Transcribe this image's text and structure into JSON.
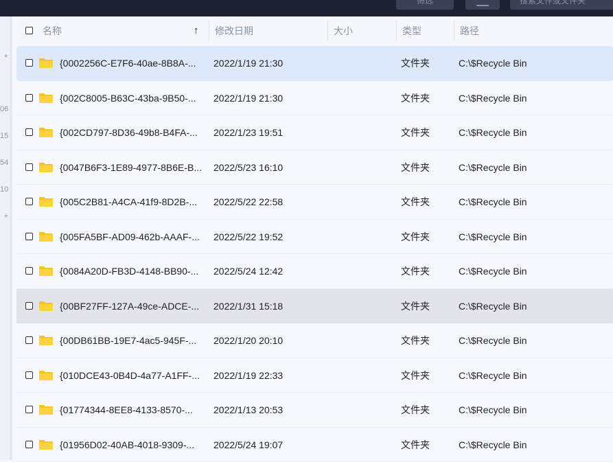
{
  "toolbar": {
    "filter_label": "筛选",
    "search_placeholder": "搜索文件或文件夹"
  },
  "sidebar": {
    "partial_labels": [
      "+",
      "06",
      "15",
      "54",
      "10",
      "+"
    ]
  },
  "table": {
    "columns": {
      "name": "名称",
      "modified": "修改日期",
      "size": "大小",
      "type": "类型",
      "path": "路径"
    },
    "sort": {
      "column": "name",
      "direction": "ascending"
    },
    "rows": [
      {
        "name": "{0002256C-E7F6-40ae-8B8A-...",
        "modified": "2022/1/19 21:30",
        "size": "",
        "type": "文件夹",
        "path": "C:\\$Recycle Bin"
      },
      {
        "name": "{002C8005-B63C-43ba-9B50-...",
        "modified": "2022/1/19 21:30",
        "size": "",
        "type": "文件夹",
        "path": "C:\\$Recycle Bin"
      },
      {
        "name": "{002CD797-8D36-49b8-B4FA-...",
        "modified": "2022/1/23 19:51",
        "size": "",
        "type": "文件夹",
        "path": "C:\\$Recycle Bin"
      },
      {
        "name": "{0047B6F3-1E89-4977-8B6E-B...",
        "modified": "2022/5/23 16:10",
        "size": "",
        "type": "文件夹",
        "path": "C:\\$Recycle Bin"
      },
      {
        "name": "{005C2B81-A4CA-41f9-8D2B-...",
        "modified": "2022/5/22 22:58",
        "size": "",
        "type": "文件夹",
        "path": "C:\\$Recycle Bin"
      },
      {
        "name": "{005FA5BF-AD09-462b-AAAF-...",
        "modified": "2022/5/22 19:52",
        "size": "",
        "type": "文件夹",
        "path": "C:\\$Recycle Bin"
      },
      {
        "name": "{0084A20D-FB3D-4148-BB90-...",
        "modified": "2022/5/24 12:42",
        "size": "",
        "type": "文件夹",
        "path": "C:\\$Recycle Bin"
      },
      {
        "name": "{00BF27FF-127A-49ce-ADCE-...",
        "modified": "2022/1/31 15:18",
        "size": "",
        "type": "文件夹",
        "path": "C:\\$Recycle Bin"
      },
      {
        "name": "{00DB61BB-19E7-4ac5-945F-...",
        "modified": "2022/1/20 20:10",
        "size": "",
        "type": "文件夹",
        "path": "C:\\$Recycle Bin"
      },
      {
        "name": "{010DCE43-0B4D-4a77-A1FF-...",
        "modified": "2022/1/19 22:33",
        "size": "",
        "type": "文件夹",
        "path": "C:\\$Recycle Bin"
      },
      {
        "name": "{01774344-8EE8-4133-8570-...",
        "modified": "2022/1/13 20:53",
        "size": "",
        "type": "文件夹",
        "path": "C:\\$Recycle Bin"
      },
      {
        "name": "{01956D02-40AB-4018-9309-...",
        "modified": "2022/5/24 19:07",
        "size": "",
        "type": "文件夹",
        "path": "C:\\$Recycle Bin"
      }
    ]
  },
  "colors": {
    "folder": "#f7c325",
    "selected_row": "#dde8fb",
    "hover_row": "#e3e3ec",
    "topbar": "#1d2133"
  }
}
